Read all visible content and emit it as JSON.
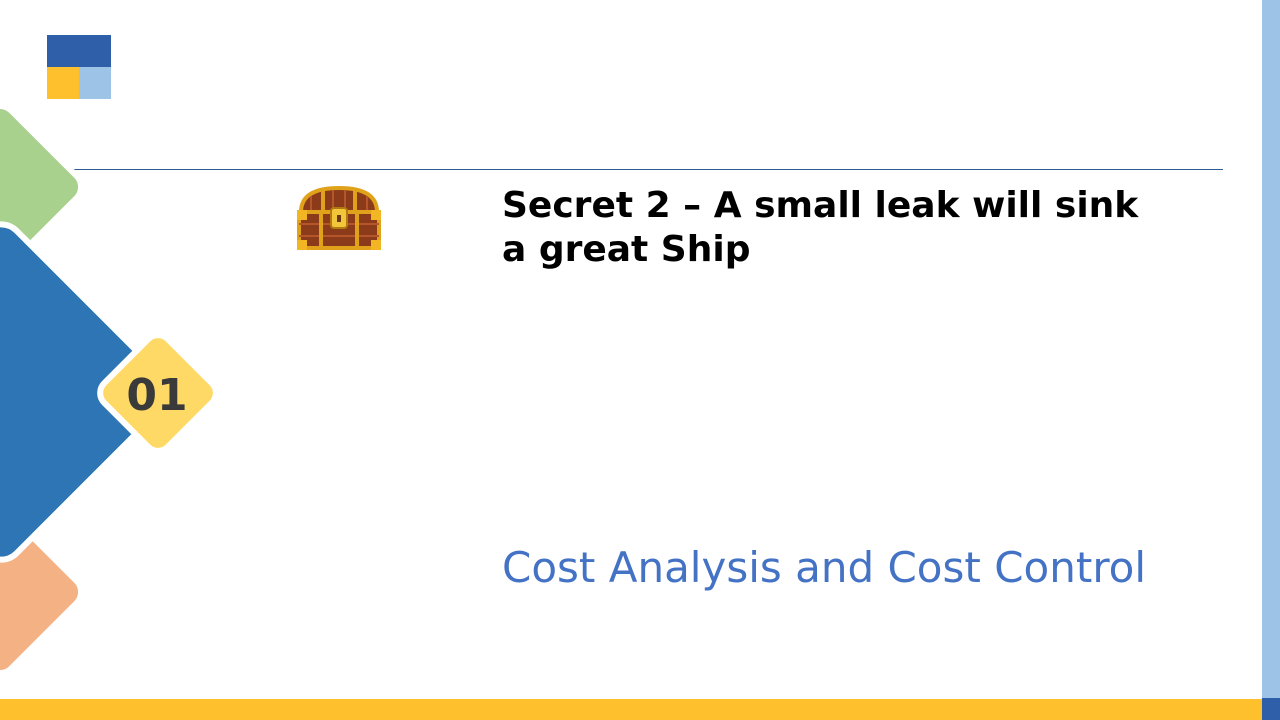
{
  "slide": {
    "title": "Secret 2 – A small leak will sink a great Ship",
    "subtitle": "Cost Analysis and Cost Control",
    "number_badge": "01"
  },
  "icons": {
    "logo": "logo-squares-icon",
    "chest": "treasure-chest-icon"
  },
  "colors": {
    "blue": "#2E75B6",
    "dark_blue": "#2F5FA8",
    "light_blue": "#9DC3E6",
    "yellow": "#FFC02E",
    "badge_yellow": "#FFD966",
    "green": "#A9D18E",
    "peach": "#F4B183",
    "subtitle_blue": "#4472C4",
    "rule": "#2E5C94"
  }
}
